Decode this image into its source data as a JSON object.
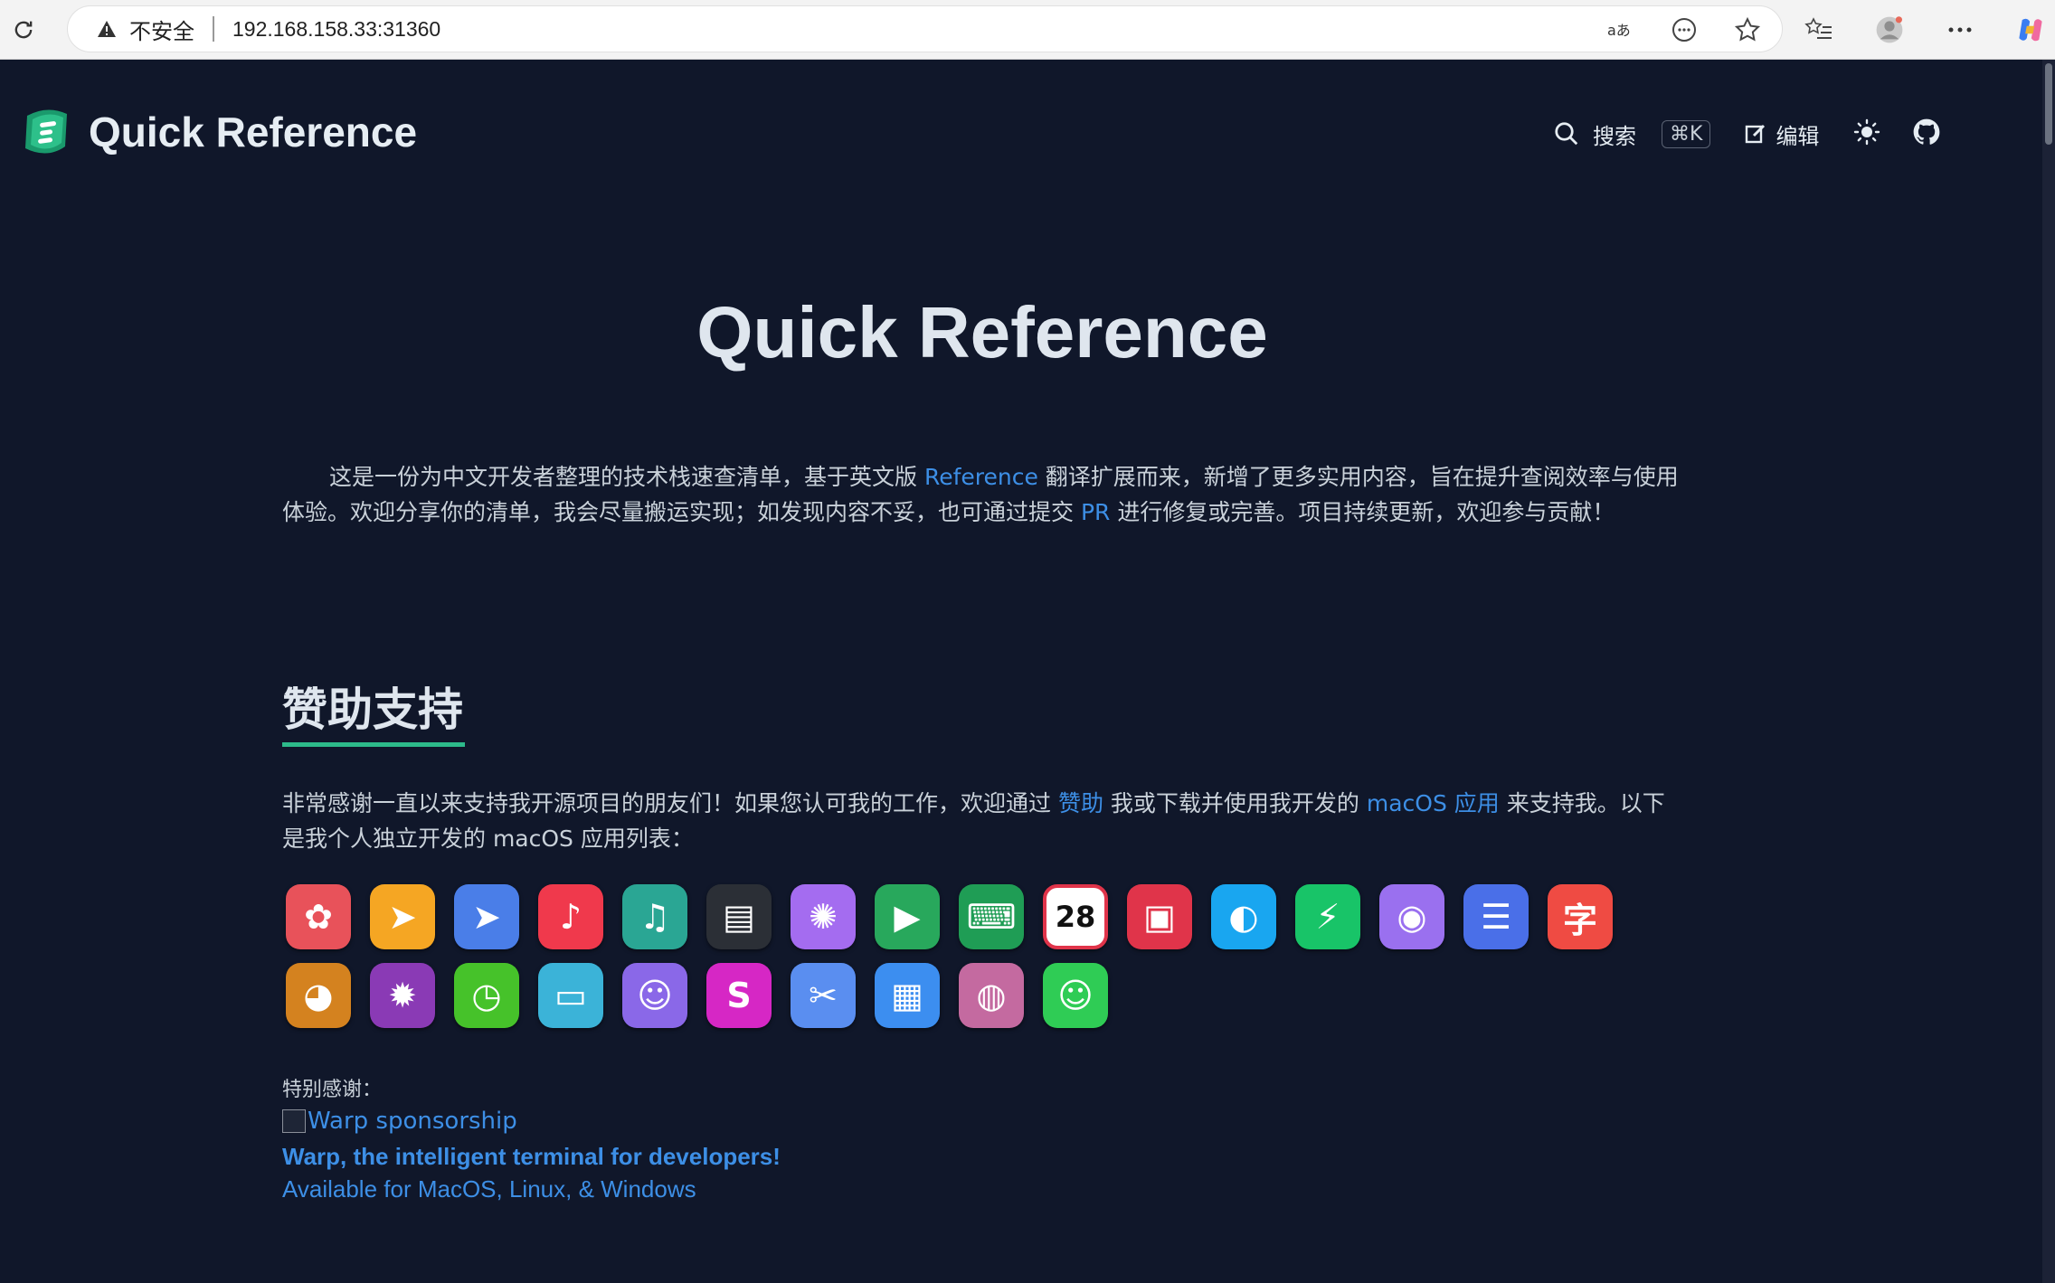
{
  "browser": {
    "insecure_label": "不安全",
    "url": "192.168.158.33:31360",
    "icons": [
      "reload-icon",
      "warning-icon",
      "read-aloud-icon",
      "more-options-icon",
      "favorite-star-icon",
      "favorites-list-icon",
      "profile-avatar-icon",
      "settings-more-icon",
      "copilot-icon"
    ]
  },
  "header": {
    "logo_text": "Quick Reference",
    "search_label": "搜索",
    "search_shortcut": "⌘K",
    "edit_label": "编辑"
  },
  "main": {
    "title": "Quick Reference",
    "intro": {
      "part1": "这是一份为中文开发者整理的技术栈速查清单，基于英文版 ",
      "link1": "Reference",
      "part2": " 翻译扩展而来，新增了更多实用内容，旨在提升查阅效率与使用体验。欢迎分享你的清单，我会尽量搬运实现；如发现内容不妥，也可通过提交 ",
      "link2": "PR",
      "part3": " 进行修复或完善。项目持续更新，欢迎参与贡献！"
    },
    "sponsor_section": {
      "heading": "赞助支持",
      "text_part1": "非常感谢一直以来支持我开源项目的朋友们！如果您认可我的工作，欢迎通过 ",
      "link_sponsor": "赞助",
      "text_part2": " 我或下载并使用我开发的 ",
      "link_apps": "macOS 应用",
      "text_part3": " 来支持我。以下是我个人独立开发的 macOS 应用列表："
    },
    "apps_row1": [
      {
        "icon": "pinwheel-app-icon",
        "glyph": "✿",
        "color": "#e8525a"
      },
      {
        "icon": "cursor-mh-app-icon",
        "glyph": "➤",
        "color": "#f5a623"
      },
      {
        "icon": "cursor-app-icon",
        "glyph": "➤",
        "color": "#4a7ee8"
      },
      {
        "icon": "music-app-icon",
        "glyph": "♪",
        "color": "#f0394c"
      },
      {
        "icon": "music-teal-app-icon",
        "glyph": "♫",
        "color": "#2aa694"
      },
      {
        "icon": "terminal-app-icon",
        "glyph": "▤",
        "color": "#2b2f36"
      },
      {
        "icon": "spark-app-icon",
        "glyph": "✺",
        "color": "#a46cf0"
      },
      {
        "icon": "play-app-icon",
        "glyph": "▶",
        "color": "#28a85c"
      },
      {
        "icon": "keyboard-app-icon",
        "glyph": "⌨",
        "color": "#1f9d55"
      },
      {
        "icon": "calendar-app-icon",
        "glyph": "28",
        "color": "#ffffff"
      },
      {
        "icon": "photo-app-icon",
        "glyph": "▣",
        "color": "#e0344a"
      },
      {
        "icon": "pointer-app-icon",
        "glyph": "◐",
        "color": "#19a6f0"
      },
      {
        "icon": "battery-app-icon",
        "glyph": "⚡",
        "color": "#18c468"
      },
      {
        "icon": "rss-app-icon",
        "glyph": "◉",
        "color": "#9a70ef"
      },
      {
        "icon": "list-app-icon",
        "glyph": "☰",
        "color": "#4a6fe8"
      },
      {
        "icon": "font-app-icon",
        "glyph": "字",
        "color": "#ef4b43"
      }
    ],
    "apps_row2": [
      {
        "icon": "bird-app-icon",
        "glyph": "◕",
        "color": "#d4821f"
      },
      {
        "icon": "color-burst-app-icon",
        "glyph": "✹",
        "color": "#8a3ab5"
      },
      {
        "icon": "timer-app-icon",
        "glyph": "◷",
        "color": "#46c22a"
      },
      {
        "icon": "folder-app-icon",
        "glyph": "▭",
        "color": "#3bb3d8"
      },
      {
        "icon": "voice-app-icon",
        "glyph": "☺",
        "color": "#8a68e8"
      },
      {
        "icon": "s-app-icon",
        "glyph": "S",
        "color": "#d627c5"
      },
      {
        "icon": "tools-app-icon",
        "glyph": "✂",
        "color": "#5a8ef0"
      },
      {
        "icon": "document-app-icon",
        "glyph": "▦",
        "color": "#3c8ef0"
      },
      {
        "icon": "globe-art-app-icon",
        "glyph": "◍",
        "color": "#c46aa0"
      },
      {
        "icon": "smile-app-icon",
        "glyph": "☺",
        "color": "#2fcc55"
      }
    ],
    "thanks_label": "特别感谢：",
    "warp_img_alt": "Warp sponsorship",
    "warp_title": "Warp, the intelligent terminal for developers!",
    "warp_sub": "Available for MacOS, Linux, & Windows"
  }
}
